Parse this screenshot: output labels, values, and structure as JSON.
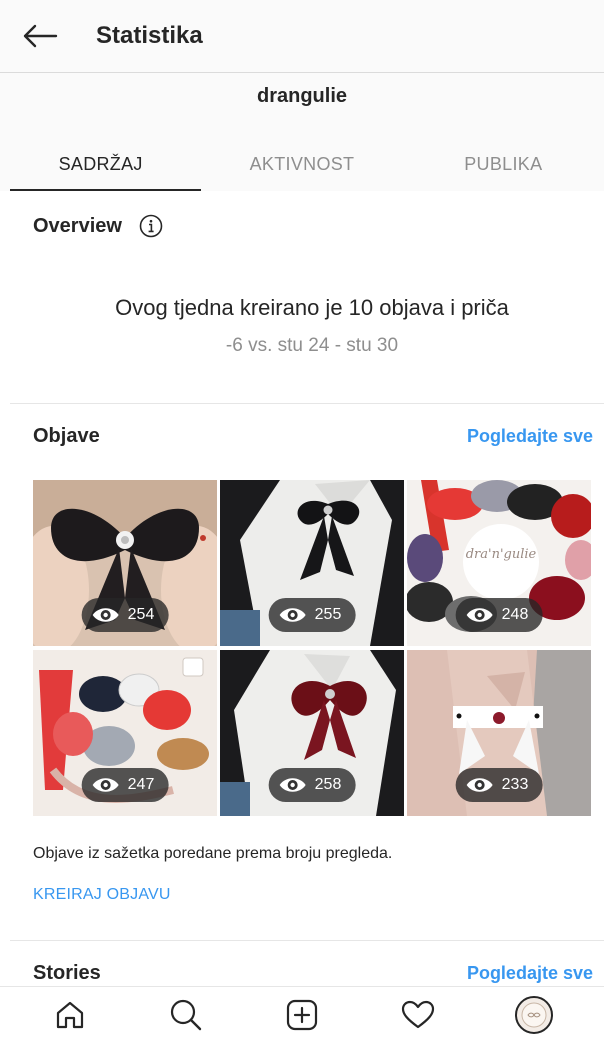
{
  "header": {
    "title": "Statistika",
    "account": "drangulie"
  },
  "tabs": [
    {
      "label": "SADRŽAJ",
      "active": true
    },
    {
      "label": "AKTIVNOST",
      "active": false
    },
    {
      "label": "PUBLIKA",
      "active": false
    }
  ],
  "overview": {
    "title": "Overview",
    "headline": "Ovog tjedna kreirano je 10 objava i priča",
    "comparison": "-6 vs. stu 24 - stu 30"
  },
  "posts": {
    "title": "Objave",
    "see_all": "Pogledajte sve",
    "items": [
      {
        "views": "254"
      },
      {
        "views": "255"
      },
      {
        "views": "248"
      },
      {
        "views": "247"
      },
      {
        "views": "258"
      },
      {
        "views": "233"
      }
    ],
    "note": "Objave iz sažetka poredane prema broju pregleda.",
    "create": "KREIRAJ OBJAVU"
  },
  "stories": {
    "title": "Stories",
    "see_all": "Pogledajte sve"
  },
  "colors": {
    "accent": "#3897f0",
    "text": "#262626",
    "muted": "#8e8e8e"
  },
  "icons": {
    "back": "arrow-left-icon",
    "info": "info-icon",
    "views": "eye-icon",
    "nav": [
      "home-icon",
      "search-icon",
      "add-post-icon",
      "heart-icon",
      "profile-avatar"
    ]
  }
}
